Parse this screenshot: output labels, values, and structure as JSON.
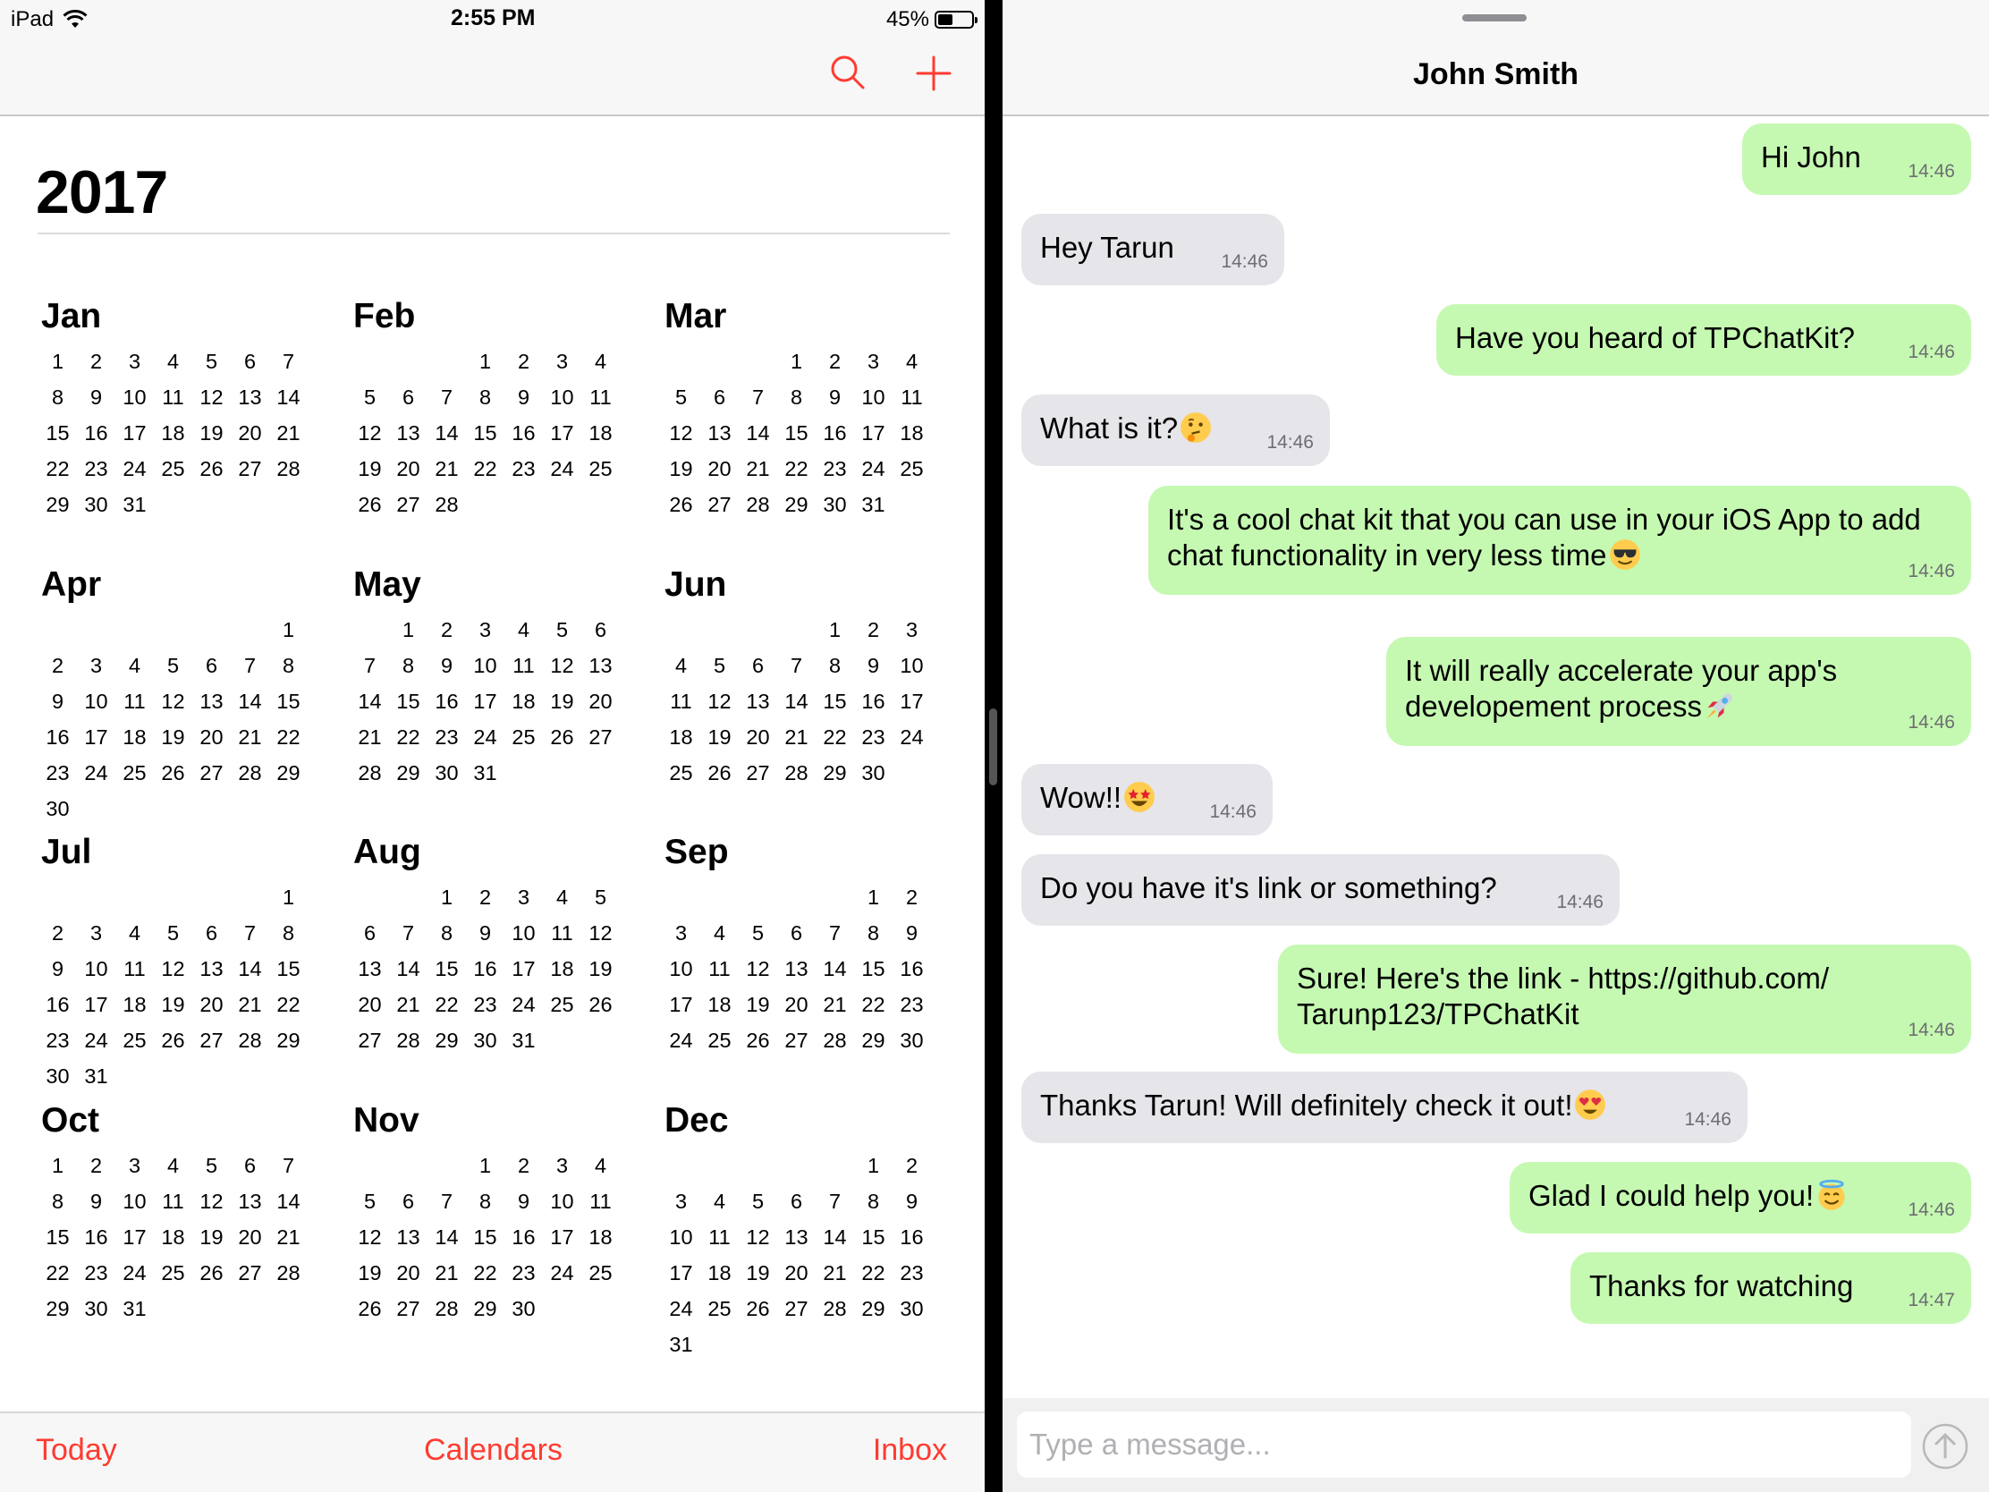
{
  "status_bar": {
    "device": "iPad",
    "time": "2:55 PM",
    "battery": "45%",
    "battery_level": 0.45
  },
  "calendar": {
    "year": "2017",
    "accent": "#ff3b30",
    "months": [
      {
        "name": "Jan",
        "offset": 0,
        "days": 31
      },
      {
        "name": "Feb",
        "offset": 3,
        "days": 28
      },
      {
        "name": "Mar",
        "offset": 3,
        "days": 31
      },
      {
        "name": "Apr",
        "offset": 6,
        "days": 30
      },
      {
        "name": "May",
        "offset": 1,
        "days": 31
      },
      {
        "name": "Jun",
        "offset": 4,
        "days": 30
      },
      {
        "name": "Jul",
        "offset": 6,
        "days": 31
      },
      {
        "name": "Aug",
        "offset": 2,
        "days": 31
      },
      {
        "name": "Sep",
        "offset": 5,
        "days": 30
      },
      {
        "name": "Oct",
        "offset": 0,
        "days": 31
      },
      {
        "name": "Nov",
        "offset": 3,
        "days": 30
      },
      {
        "name": "Dec",
        "offset": 5,
        "days": 31
      }
    ],
    "tabs": {
      "today": "Today",
      "calendars": "Calendars",
      "inbox": "Inbox"
    }
  },
  "chat": {
    "contact": "John Smith",
    "outgoing_color": "#c5f9b2",
    "incoming_color": "#e5e5ea",
    "messages": [
      {
        "dir": "out",
        "lines": [
          "Hi John"
        ],
        "emoji": "",
        "time": "14:46"
      },
      {
        "dir": "in",
        "lines": [
          "Hey Tarun"
        ],
        "emoji": "",
        "time": "14:46"
      },
      {
        "dir": "out",
        "lines": [
          "Have you heard of TPChatKit?"
        ],
        "emoji": "",
        "time": "14:46"
      },
      {
        "dir": "in",
        "lines": [
          "What is it?"
        ],
        "emoji": "thinking-face",
        "time": "14:46"
      },
      {
        "dir": "out",
        "lines": [
          "It's a cool chat kit that you can use in your iOS App to add",
          "chat functionality in very less time"
        ],
        "emoji": "sunglasses-face",
        "time": "14:46"
      },
      {
        "dir": "out",
        "lines": [
          "It will really accelerate your app's",
          "developement process"
        ],
        "emoji": "rocket",
        "time": "14:46"
      },
      {
        "dir": "in",
        "lines": [
          "Wow!!"
        ],
        "emoji": "star-struck-face",
        "time": "14:46"
      },
      {
        "dir": "in",
        "lines": [
          "Do you have it's link or something?"
        ],
        "emoji": "",
        "time": "14:46"
      },
      {
        "dir": "out",
        "lines": [
          "Sure! Here's the link - https://github.com/",
          "Tarunp123/TPChatKit"
        ],
        "emoji": "",
        "time": "14:46"
      },
      {
        "dir": "in",
        "lines": [
          "Thanks Tarun! Will definitely check it out!"
        ],
        "emoji": "heart-eyes-face",
        "time": "14:46"
      },
      {
        "dir": "out",
        "lines": [
          "Glad I could help you!"
        ],
        "emoji": "halo-face",
        "time": "14:46"
      },
      {
        "dir": "out",
        "lines": [
          "Thanks for watching"
        ],
        "emoji": "",
        "time": "14:47"
      }
    ],
    "input_placeholder": "Type a message..."
  }
}
